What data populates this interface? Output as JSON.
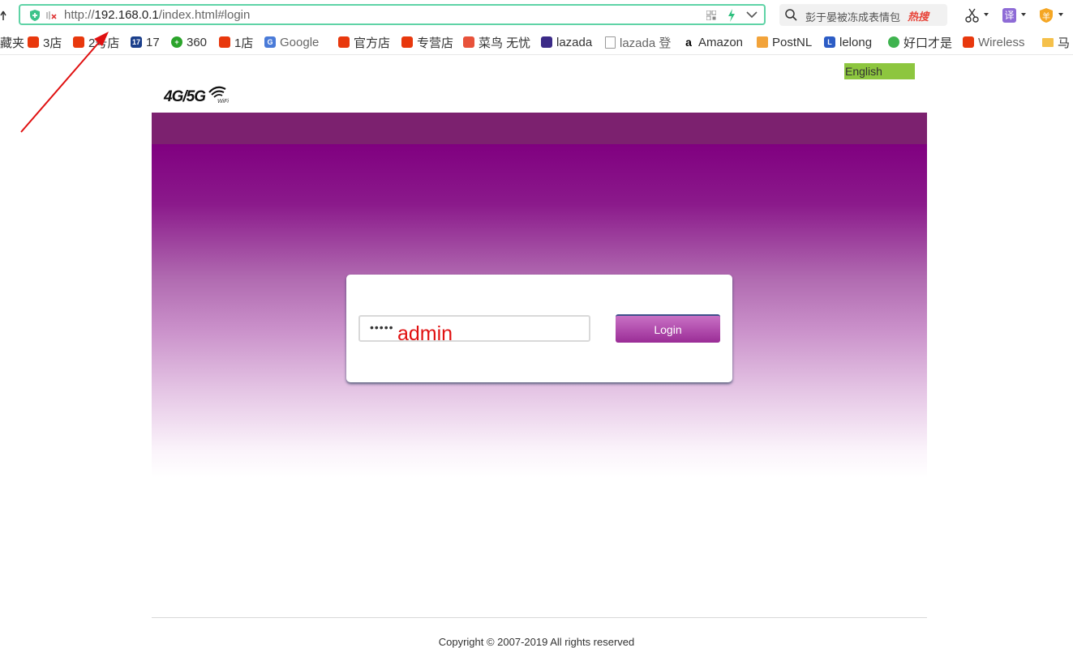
{
  "browser": {
    "url_prefix": "http://",
    "url_host": "192.168.0.1",
    "url_path": "/index.html#login",
    "search_text": "彭于晏被冻成表情包",
    "hot_badge": "热搜",
    "translate_label": "译",
    "profile_label": "羊"
  },
  "bookmarks": [
    {
      "label": "藏夹",
      "icon": "none"
    },
    {
      "label": "3店",
      "icon": "taobao"
    },
    {
      "label": "2号店",
      "icon": "taobao"
    },
    {
      "label": "17",
      "icon": "seventeen"
    },
    {
      "label": "360",
      "icon": "three60"
    },
    {
      "label": "1店",
      "icon": "taobao"
    },
    {
      "label": "Google",
      "icon": "google"
    },
    {
      "label": "官方店",
      "icon": "taobao"
    },
    {
      "label": "专营店",
      "icon": "taobao"
    },
    {
      "label": "菜鸟 无忧",
      "icon": "cainiao"
    },
    {
      "label": "lazada",
      "icon": "lazada"
    },
    {
      "label": "lazada 登",
      "icon": "page"
    },
    {
      "label": "Amazon",
      "icon": "amazon"
    },
    {
      "label": "PostNL",
      "icon": "postnl"
    },
    {
      "label": "lelong",
      "icon": "lelong"
    },
    {
      "label": "好口才是",
      "icon": "haokou"
    },
    {
      "label": "Wireless",
      "icon": "taobao"
    },
    {
      "label": "马",
      "icon": "folder"
    }
  ],
  "router": {
    "language": "English",
    "logo_text": "4G/5G",
    "logo_sub": "WiFi",
    "password_value": "•••••",
    "login_label": "Login",
    "annotation": "admin",
    "copyright": "Copyright © 2007-2019 All rights reserved"
  }
}
